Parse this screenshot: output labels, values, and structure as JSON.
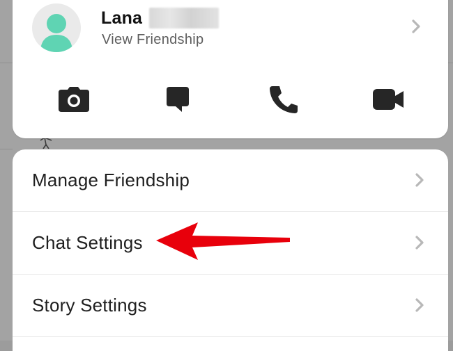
{
  "profile": {
    "name": "Lana",
    "subtitle": "View Friendship"
  },
  "actions": [
    {
      "icon": "camera-icon"
    },
    {
      "icon": "chat-icon"
    },
    {
      "icon": "phone-icon"
    },
    {
      "icon": "video-icon"
    }
  ],
  "settings": {
    "items": [
      {
        "label": "Manage Friendship"
      },
      {
        "label": "Chat Settings"
      },
      {
        "label": "Story Settings"
      }
    ]
  },
  "colors": {
    "overlay": "#a3a3a3",
    "card": "#ffffff",
    "avatar_figure": "#5fd4b3",
    "icon": "#262626",
    "chevron": "#b8b8b8",
    "arrow": "#e8000b"
  }
}
